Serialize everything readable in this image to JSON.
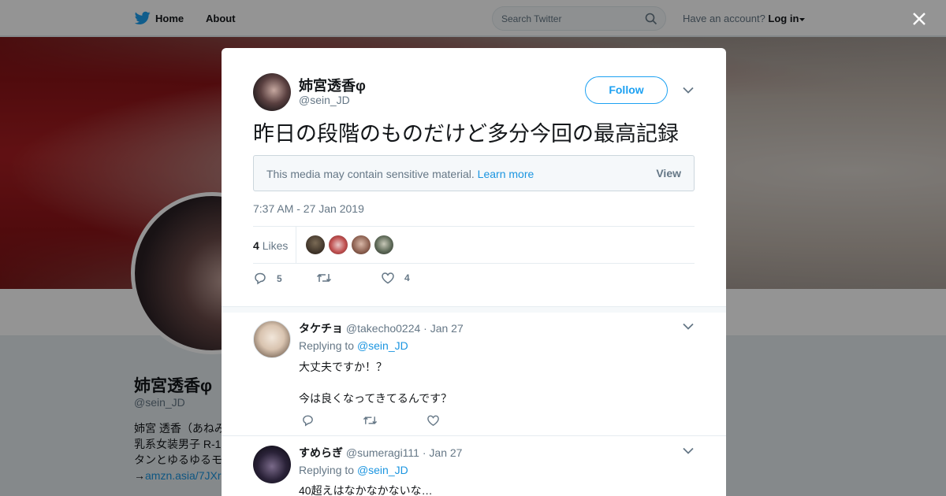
{
  "nav": {
    "home_label": "Home",
    "about_label": "About",
    "search_placeholder": "Search Twitter",
    "account_prompt": "Have an account?",
    "login_label": "Log in"
  },
  "background_profile": {
    "name": "姉宮透香φ",
    "handle": "@sein_JD",
    "bio_lines": [
      "姉宮 透香（あねみ",
      "乳系女装男子 R-1",
      "タンとゆるゆるモ"
    ],
    "bio_link": "amzn.asia/7JXr",
    "bio_link_prefix": "→"
  },
  "tweet": {
    "author_name": "姉宮透香φ",
    "author_handle": "@sein_JD",
    "follow_label": "Follow",
    "text": "昨日の段階のものだけど多分今回の最高記録",
    "sensitive_text": "This media may contain sensitive material.",
    "learn_more_label": "Learn more",
    "view_label": "View",
    "timestamp": "7:37 AM - 27 Jan 2019",
    "likes_count": "4",
    "likes_label": "Likes",
    "reply_count": "5",
    "retweet_count": "",
    "like_count": "4"
  },
  "replies": [
    {
      "name": "タケチョ",
      "handle": "@takecho0224",
      "date": "· Jan 27",
      "replying_label": "Replying to",
      "replying_to": "@sein_JD",
      "lines": [
        "大丈夫ですか！？",
        "今は良くなってきてるんです？"
      ]
    },
    {
      "name": "すめらぎ",
      "handle": "@sumeragi111",
      "date": "· Jan 27",
      "replying_label": "Replying to",
      "replying_to": "@sein_JD",
      "lines": [
        "40超えはなかなかないな…"
      ]
    }
  ],
  "colors": {
    "accent": "#1da1f2",
    "link": "#1b95e0",
    "muted": "#657786"
  }
}
